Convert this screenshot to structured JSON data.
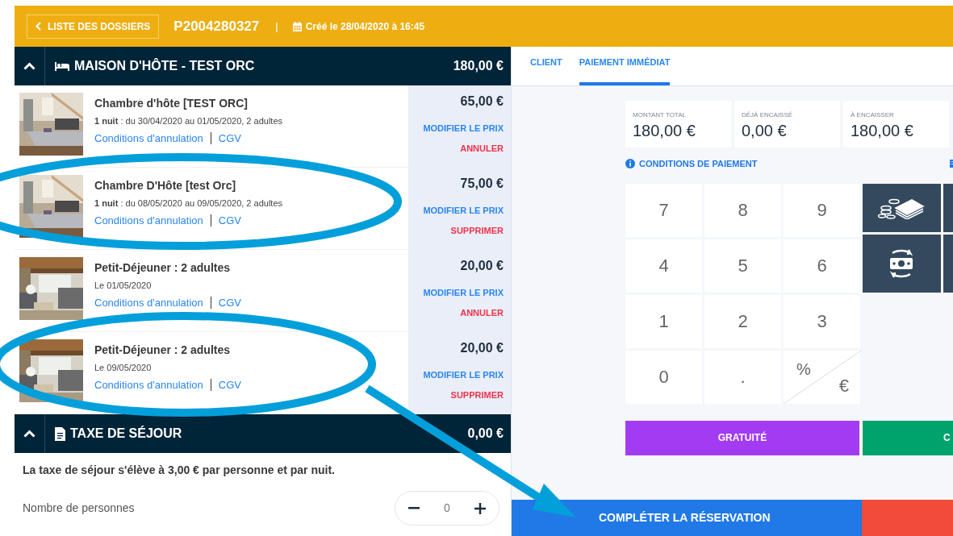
{
  "header": {
    "back_button": "LISTE DES DOSSIERS",
    "dossier": "P2004280327",
    "separator": "|",
    "created": "Créé le 28/04/2020 à 16:45"
  },
  "lodging": {
    "title": "MAISON D'HÔTE - TEST ORC",
    "total": "180,00 €",
    "expanded": true,
    "items": [
      {
        "name": "Chambre d'hôte [TEST ORC]",
        "detail": "**1 nuit** : du 30/04/2020 au 01/05/2020, 2 adultes",
        "links": [
          "Conditions d'annulation",
          "CGV"
        ],
        "price": "65,00 €",
        "edit": "MODIFIER LE PRIX",
        "action": "ANNULER"
      },
      {
        "name": "Chambre D'Hôte [test Orc]",
        "detail": "**1 nuit** : du 08/05/2020 au 09/05/2020, 2 adultes",
        "links": [
          "Conditions d'annulation",
          "CGV"
        ],
        "price": "75,00 €",
        "edit": "MODIFIER LE PRIX",
        "action": "SUPPRIMER"
      },
      {
        "name": "Petit-Déjeuner : 2 adultes",
        "detail": "Le 01/05/2020",
        "links": [
          "Conditions d'annulation",
          "CGV"
        ],
        "price": "20,00 €",
        "edit": "MODIFIER LE PRIX",
        "action": "ANNULER"
      },
      {
        "name": "Petit-Déjeuner : 2 adultes",
        "detail": "Le 09/05/2020",
        "links": [
          "Conditions d'annulation",
          "CGV"
        ],
        "price": "20,00 €",
        "edit": "MODIFIER LE PRIX",
        "action": "SUPPRIMER"
      }
    ]
  },
  "tax": {
    "title": "TAXE DE SÉJOUR",
    "total": "0,00 €",
    "expanded": true,
    "note": "La taxe de séjour s'élève à 3,00 € par personne et par nuit.",
    "fields": [
      {
        "label": "Nombre de personnes",
        "value": "0"
      }
    ]
  },
  "tabs": [
    {
      "label": "CLIENT",
      "selected": false
    },
    {
      "label": "PAIEMENT IMMÉDIAT",
      "selected": true
    }
  ],
  "amounts": [
    {
      "label": "MONTANT TOTAL",
      "value": "180,00 €"
    },
    {
      "label": "DÉJÀ ENCAISSÉ",
      "value": "0,00 €"
    },
    {
      "label": "À ENCAISSER",
      "value": "180,00 €"
    }
  ],
  "payment_conditions": "CONDITIONS DE PAIEMENT",
  "keypad": [
    "7",
    "8",
    "9",
    "4",
    "5",
    "6",
    "1",
    "2",
    "3",
    "0",
    "."
  ],
  "switch_key": {
    "top": "%",
    "bottom": "€"
  },
  "action_buttons": [
    {
      "label": "GRATUITÉ",
      "color": "#a33bf3"
    },
    {
      "label": "C",
      "color": "#00a36c"
    }
  ],
  "complete_button": "COMPLÉTER LA RÉSERVATION"
}
